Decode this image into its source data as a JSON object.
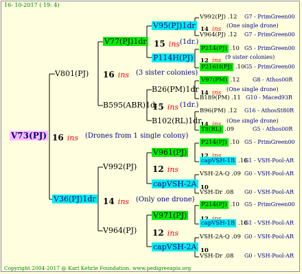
{
  "header": {
    "date": "16- 10-2017 ( 19: 4)"
  },
  "footer": {
    "copyright": "Copyright 2004-2017 @ Karl Kehrle Foundation.   www.pedigreeapis.org"
  },
  "root": {
    "name": "V73(PJ)",
    "ins": "16",
    "ins_word": "ins",
    "note": "(Drones from 1 single colony)"
  },
  "sire_top": {
    "name": "V801(PJ)",
    "ins": "16",
    "ins_word": "ins",
    "note": "(3 sister colonies)"
  },
  "sire_bot": {
    "name": "V36(PJ)1dr",
    "ins": "14",
    "ins_word": "ins",
    "note": "(Only one drone)"
  },
  "n_v77": {
    "name": "V77(PJ)1dr",
    "ins": "15",
    "ins_word": "ins",
    "note": "(1dr.)"
  },
  "n_b595": {
    "name": "B595(ABR)1d:",
    "ins": "15",
    "ins_word": "ins",
    "note": "(1dr.)"
  },
  "n_v992": {
    "name": "V992(PJ)",
    "ins": "12",
    "ins_word": "ins"
  },
  "n_v964": {
    "name": "V964(PJ)",
    "ins": "12",
    "ins_word": "ins"
  },
  "g3": {
    "v95": {
      "name": "V95(PJ)1dr",
      "ins": "14",
      "ins_word": "ins",
      "note": "(One single drone)"
    },
    "p114": {
      "name": "P114H(PJ)",
      "ins": "12",
      "ins_word": "ins",
      "note": "(9 sister colonies)"
    },
    "b26": {
      "name": "B26(PM)1dr",
      "ins": "14",
      "ins_word": "ins",
      "note": "(One single drone)"
    },
    "b102": {
      "name": "B102(RL)1dr",
      "ins": "14",
      "ins_word": "ins",
      "note": "(One single drone)"
    },
    "v961": {
      "name": "V961(PJ)",
      "ins": "12",
      "ins_word": "ins"
    },
    "cap1": {
      "name": "capVSH-2A",
      "ins": "10"
    },
    "v971": {
      "name": "V971(PJ)",
      "ins": "12",
      "ins_word": "ins"
    },
    "cap2": {
      "name": "capVSH-2A",
      "ins": "10"
    }
  },
  "g4": [
    {
      "name": "V992(PJ)",
      "ins": ".12",
      "gen": "G7 - PrimGreen00"
    },
    {
      "name": "V964(PJ)",
      "ins": ".12",
      "gen": "G7 - PrimGreen00"
    },
    {
      "name": "P214(PJ)",
      "ins": ".10",
      "gen": "G5 - PrimGreen00"
    },
    {
      "name": "P216H(PJ)",
      "ins": ".10",
      "gen": "G5 - PrimGreen00"
    },
    {
      "name": "V97(PM)",
      "ins": ".12",
      "gen": "G8 - Athos00R"
    },
    {
      "name": "B189(PM)",
      "ins": ".11",
      "gen": "G10 - Maced93R"
    },
    {
      "name": "B96(PM)",
      "ins": ".12",
      "gen": "G16 - AthosSt80R"
    },
    {
      "name": "T8(RL)",
      "ins": ".09",
      "gen": "G5 - Athos00R"
    },
    {
      "name": "P214(PJ)",
      "ins": ".10",
      "gen": "G5 - PrimGreen00"
    },
    {
      "name": "capVSH-1B",
      "ins": ".10",
      "gen": "G1 - VSH-Pool-AR"
    },
    {
      "name": "VSH-2A-Q",
      "ins": ".09",
      "gen": "G0 - VSH-Pool-AR"
    },
    {
      "name": "VSH-Dr",
      "ins": ".08",
      "gen": "G0 - VSH-Pool-AR"
    },
    {
      "name": "P214(PJ)",
      "ins": ".10",
      "gen": "G5 - PrimGreen00"
    },
    {
      "name": "capVSH-1B",
      "ins": ".10",
      "gen": "G1 - VSH-Pool-AR"
    },
    {
      "name": "VSH-2A-Q",
      "ins": ".09",
      "gen": "G0 - VSH-Pool-AR"
    },
    {
      "name": "VSH-Dr",
      "ins": ".08",
      "gen": "G0 - VSH-Pool-AR"
    }
  ],
  "colors": {
    "background": "#ffffe0",
    "root_box": "#ffbbff",
    "green_box": "#00ee00",
    "cyan_box": "#00eeee",
    "ins_red": "#ff0000",
    "note_blue": "#000080",
    "copyright_green": "#008000"
  }
}
